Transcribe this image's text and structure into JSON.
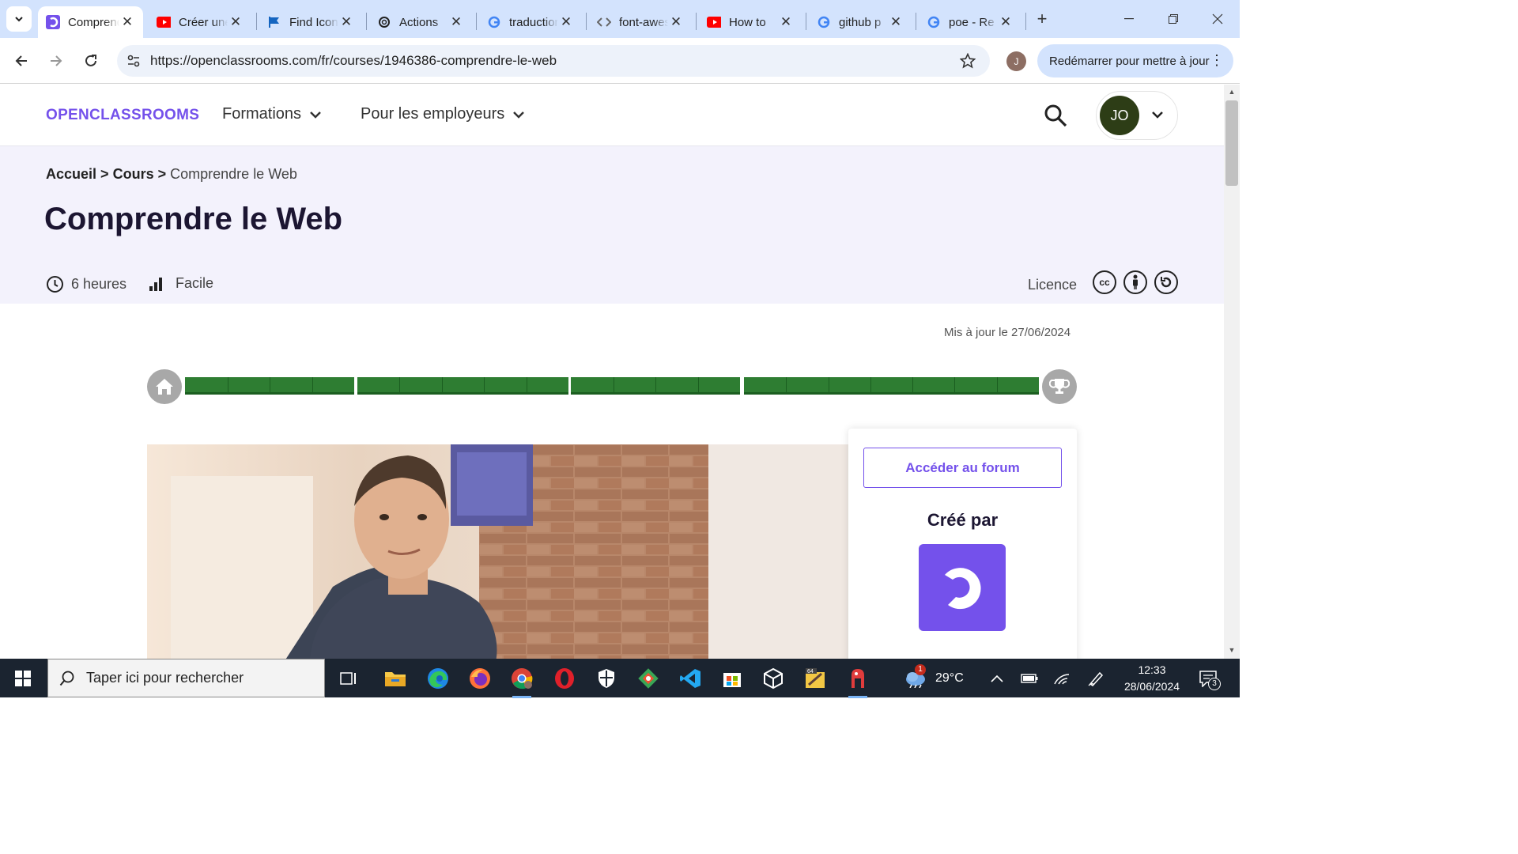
{
  "browser": {
    "tabs": [
      {
        "title": "Comprendre le Web",
        "icon": "openclassrooms-favicon",
        "active": true
      },
      {
        "title": "Créer une",
        "icon": "youtube-favicon"
      },
      {
        "title": "Find Icons",
        "icon": "flag-favicon"
      },
      {
        "title": "Actions",
        "icon": "openai-favicon"
      },
      {
        "title": "traduction",
        "icon": "google-favicon"
      },
      {
        "title": "font-awesome",
        "icon": "code-favicon"
      },
      {
        "title": "How to",
        "icon": "youtube-favicon"
      },
      {
        "title": "github p",
        "icon": "google-favicon"
      },
      {
        "title": "poe - Re",
        "icon": "google-favicon"
      }
    ],
    "new_tab": "+",
    "url": "https://openclassrooms.com/fr/courses/1946386-comprendre-le-web",
    "profile_initial": "J",
    "update_button": "Redémarrer pour mettre à jour"
  },
  "site": {
    "logo": "OPENCLASSROOMS",
    "nav": [
      "Formations",
      "Pour les employeurs"
    ],
    "user_initials": "JO"
  },
  "course": {
    "breadcrumb": {
      "home": "Accueil",
      "courses": "Cours",
      "current": "Comprendre le Web",
      "sep": ">"
    },
    "title": "Comprendre le Web",
    "duration": "6 heures",
    "level": "Facile",
    "licence_label": "Licence",
    "updated": "Mis à jour le 27/06/2024",
    "progress_fraction": 1.0,
    "forum_button": "Accéder au forum",
    "created_by": "Créé par"
  },
  "taskbar": {
    "search_placeholder": "Taper ici pour rechercher",
    "weather": "29°C",
    "weather_badge": "1",
    "time": "12:33",
    "date": "28/06/2024",
    "notifications": "3",
    "apps": [
      "task-view",
      "file-explorer",
      "edge",
      "firefox",
      "chrome",
      "opera",
      "security",
      "git",
      "vscode",
      "microsoft-store",
      "virtualbox",
      "app-64",
      "gitkraken"
    ]
  },
  "colors": {
    "brand": "#7451eb",
    "progress": "#2e7d32",
    "tabstrip": "#d3e3fd"
  }
}
